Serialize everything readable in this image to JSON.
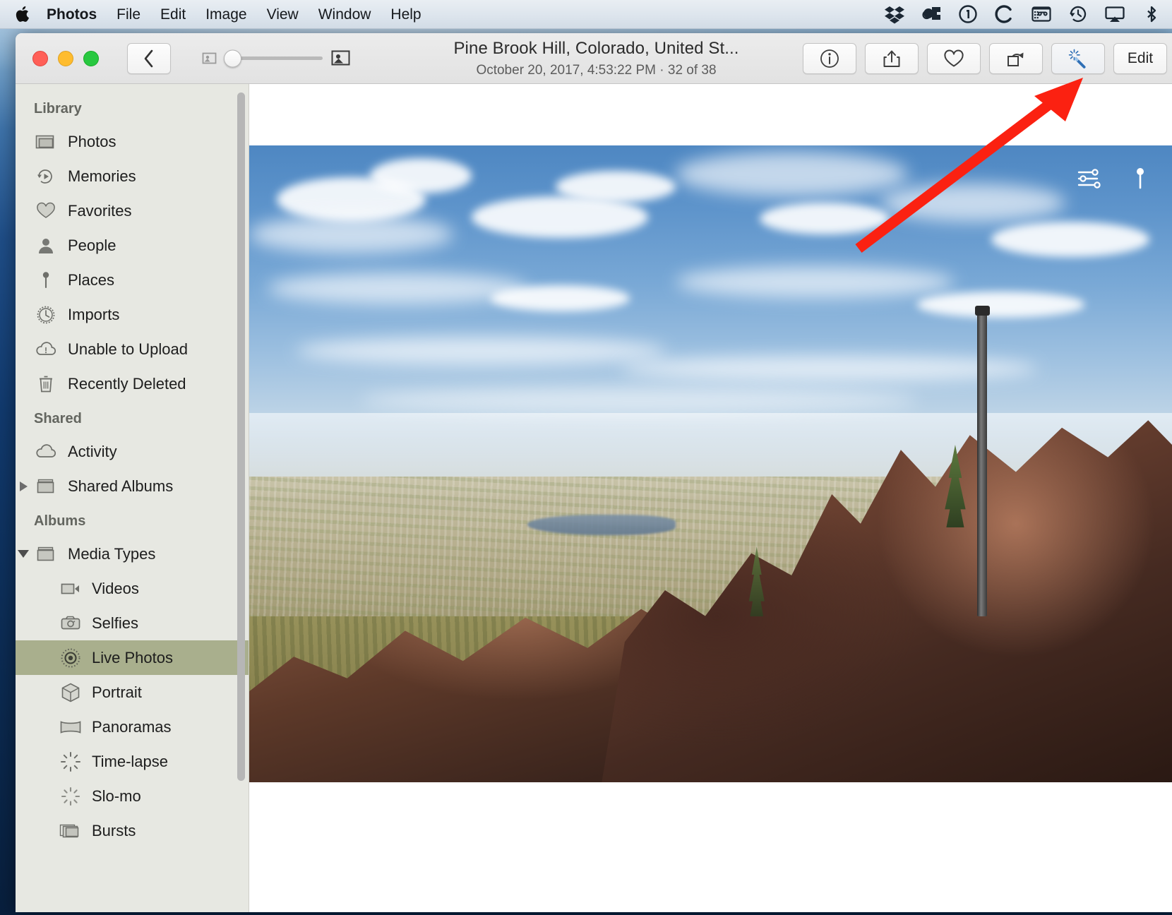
{
  "menubar": {
    "apple_icon": "apple-logo-icon",
    "items": [
      {
        "label": "Photos",
        "bold": true
      },
      {
        "label": "File",
        "bold": false
      },
      {
        "label": "Edit",
        "bold": false
      },
      {
        "label": "Image",
        "bold": false
      },
      {
        "label": "View",
        "bold": false
      },
      {
        "label": "Window",
        "bold": false
      },
      {
        "label": "Help",
        "bold": false
      }
    ],
    "status_icons": [
      {
        "name": "dropbox-icon"
      },
      {
        "name": "cloud-sync-icon"
      },
      {
        "name": "one-password-icon"
      },
      {
        "name": "letter-c-icon"
      },
      {
        "name": "keyboard-shortcut-icon"
      },
      {
        "name": "time-machine-icon"
      },
      {
        "name": "airplay-icon"
      },
      {
        "name": "bluetooth-icon"
      }
    ]
  },
  "window": {
    "traffic_lights": {
      "close": "close-window-button",
      "minimize": "minimize-window-button",
      "zoom": "maximize-window-button"
    },
    "toolbar": {
      "back_label": "",
      "back_icon": "chevron-left-icon",
      "zoom_slider": {
        "small_icon": "small-thumbnail-icon",
        "large_icon": "large-thumbnail-icon",
        "value": 0
      },
      "title": "Pine Brook Hill, Colorado, United St...",
      "subtitle": "October 20, 2017, 4:53:22 PM  ·  32 of 38",
      "buttons": [
        {
          "name": "info-button",
          "icon": "info-circle-icon",
          "label": ""
        },
        {
          "name": "share-button",
          "icon": "share-arrow-icon",
          "label": ""
        },
        {
          "name": "favorite-button",
          "icon": "heart-icon",
          "label": ""
        },
        {
          "name": "rotate-button",
          "icon": "rotate-icon",
          "label": ""
        },
        {
          "name": "auto-enhance-button",
          "icon": "magic-wand-icon",
          "label": ""
        }
      ],
      "edit_label": "Edit"
    }
  },
  "sidebar": {
    "groups": [
      {
        "label": "Library",
        "items": [
          {
            "label": "Photos",
            "icon": "photos-stack-icon",
            "selected": false,
            "indent": false
          },
          {
            "label": "Memories",
            "icon": "memories-play-icon",
            "selected": false,
            "indent": false
          },
          {
            "label": "Favorites",
            "icon": "heart-icon",
            "selected": false,
            "indent": false
          },
          {
            "label": "People",
            "icon": "person-icon",
            "selected": false,
            "indent": false
          },
          {
            "label": "Places",
            "icon": "map-pin-icon",
            "selected": false,
            "indent": false
          },
          {
            "label": "Imports",
            "icon": "clock-icon",
            "selected": false,
            "indent": false
          },
          {
            "label": "Unable to Upload",
            "icon": "cloud-warning-icon",
            "selected": false,
            "indent": false
          },
          {
            "label": "Recently Deleted",
            "icon": "trash-icon",
            "selected": false,
            "indent": false
          }
        ]
      },
      {
        "label": "Shared",
        "items": [
          {
            "label": "Activity",
            "icon": "cloud-icon",
            "selected": false,
            "indent": false
          },
          {
            "label": "Shared Albums",
            "icon": "album-stack-icon",
            "selected": false,
            "indent": false,
            "disclosure": "right"
          }
        ]
      },
      {
        "label": "Albums",
        "items": [
          {
            "label": "Media Types",
            "icon": "album-stack-icon",
            "selected": false,
            "indent": false,
            "disclosure": "down"
          },
          {
            "label": "Videos",
            "icon": "video-camera-icon",
            "selected": false,
            "indent": true
          },
          {
            "label": "Selfies",
            "icon": "camera-icon",
            "selected": false,
            "indent": true
          },
          {
            "label": "Live Photos",
            "icon": "live-photo-icon",
            "selected": true,
            "indent": true
          },
          {
            "label": "Portrait",
            "icon": "cube-icon",
            "selected": false,
            "indent": true
          },
          {
            "label": "Panoramas",
            "icon": "panorama-icon",
            "selected": false,
            "indent": true
          },
          {
            "label": "Time-lapse",
            "icon": "time-lapse-icon",
            "selected": false,
            "indent": true
          },
          {
            "label": "Slo-mo",
            "icon": "slo-mo-icon",
            "selected": false,
            "indent": true
          },
          {
            "label": "Bursts",
            "icon": "bursts-icon",
            "selected": false,
            "indent": true
          }
        ]
      }
    ]
  },
  "photo_view": {
    "alt": "Panoramic view from Pine Brook Hill over Boulder, Colorado with red sandstone rocks in the foreground",
    "overlay_icons": [
      {
        "name": "adjust-sliders-icon"
      },
      {
        "name": "location-pin-icon"
      }
    ]
  },
  "annotation": {
    "arrow_color": "#fb2111",
    "points_to": "edit-button"
  },
  "colors": {
    "selection_green": "#a9af8d",
    "sidebar_bg": "#e7e8e2",
    "toolbar_bg": "#ececec",
    "menubar_bg": "#e4ebf1",
    "accent_red": "#fb2111"
  }
}
